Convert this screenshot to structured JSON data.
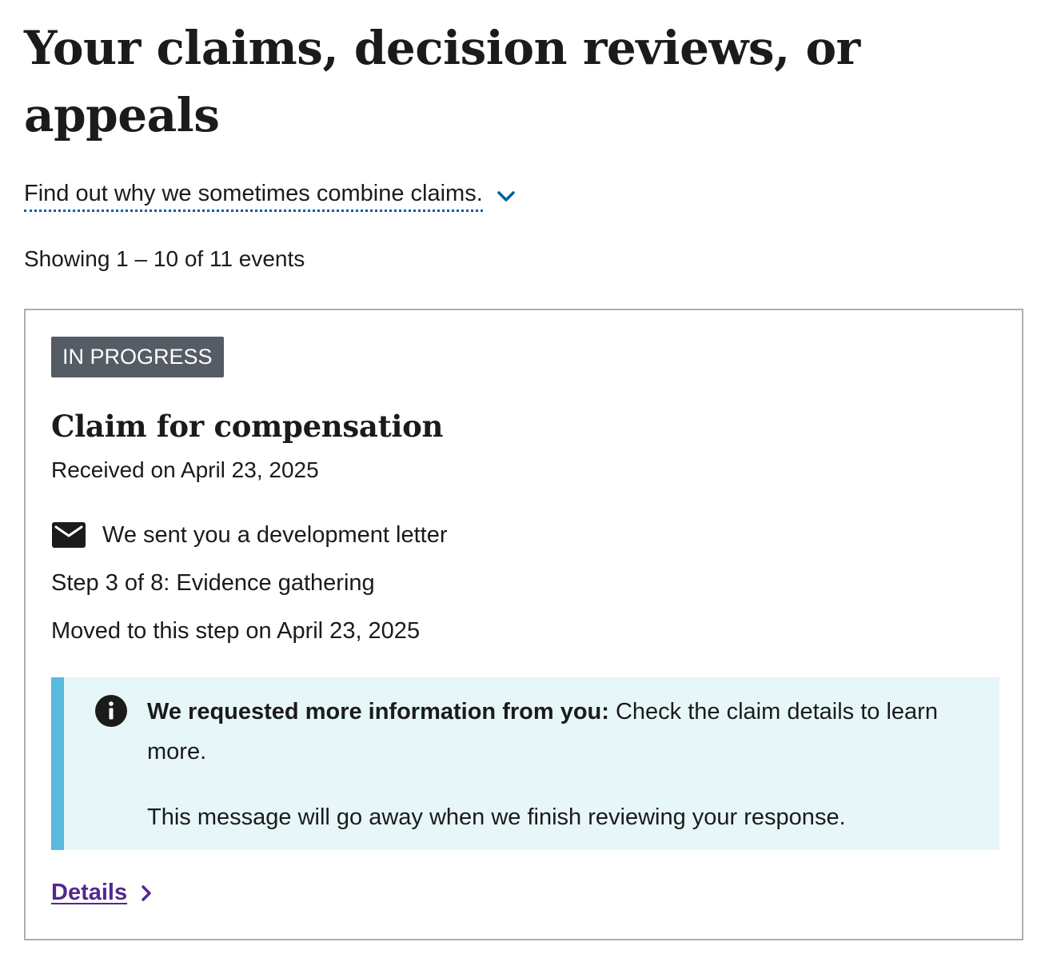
{
  "header": {
    "title": "Your claims, decision reviews, or appeals",
    "combine_link": "Find out why we sometimes combine claims."
  },
  "listing": {
    "showing_text": "Showing 1 – 10 of 11 events"
  },
  "card": {
    "status_badge": "IN PROGRESS",
    "title": "Claim for compensation",
    "received": "Received on April 23, 2025",
    "letter_text": "We sent you a development letter",
    "step": "Step 3 of 8: Evidence gathering",
    "moved": "Moved to this step on April 23, 2025",
    "alert": {
      "strong": "We requested more information from you:",
      "text": " Check the claim details to learn more.",
      "note": "This message will go away when we finish reviewing your response."
    },
    "details_label": "Details"
  },
  "icons": {
    "combine_chevron": "chevron-down-icon",
    "letter": "mail-icon",
    "alert": "info-icon",
    "details_chevron": "chevron-right-icon"
  },
  "colors": {
    "link_underline": "#005ea2",
    "badge_bg": "#565c65",
    "alert_bg": "#e7f6f8",
    "alert_border": "#59b9de",
    "details_link": "#54278f"
  }
}
